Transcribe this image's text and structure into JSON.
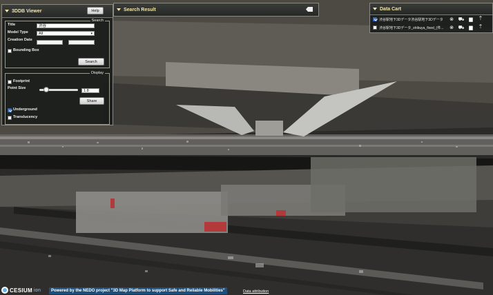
{
  "viewer": {
    "title": "3DDB Viewer",
    "help_label": "Help",
    "search": {
      "legend": "Search",
      "title_label": "Title",
      "title_value": "渋谷",
      "model_type_label": "Model Type",
      "model_type_value": "All",
      "creation_date_label": "Creation Date",
      "bounding_box_label": "Bounding Box",
      "search_button": "Search"
    },
    "display": {
      "legend": "Display",
      "footprint_label": "Footprint",
      "point_size_label": "Point Size",
      "point_size_value": "1.8",
      "point_size_level": 0.18,
      "share_button": "Share",
      "underground_label": "Underground",
      "underground_checked": true,
      "translucency_label": "Translucency",
      "translucency_checked": false
    }
  },
  "search_result": {
    "title": "Search Result",
    "clear_icon": "backspace-icon"
  },
  "data_cart": {
    "title": "Data Cart",
    "items": [
      {
        "label": "渋谷駅地下3Dデータ渋谷駅地下3Dデータ",
        "checked": true
      },
      {
        "label": "渋谷駅地下3Dデータ_shibuya_fixed_(件...",
        "checked": false
      }
    ],
    "item_icons": [
      "close-circle-icon",
      "cart-download-icon",
      "chart-icon",
      "export-icon"
    ]
  },
  "footer": {
    "cesium_brand": "CESIUM",
    "cesium_ion": "ion",
    "powered_by": "Powered by the NEDO project \"3D Map Platform to support Safe and Reliable Mobilities\"",
    "attribution": "Data attribution"
  }
}
